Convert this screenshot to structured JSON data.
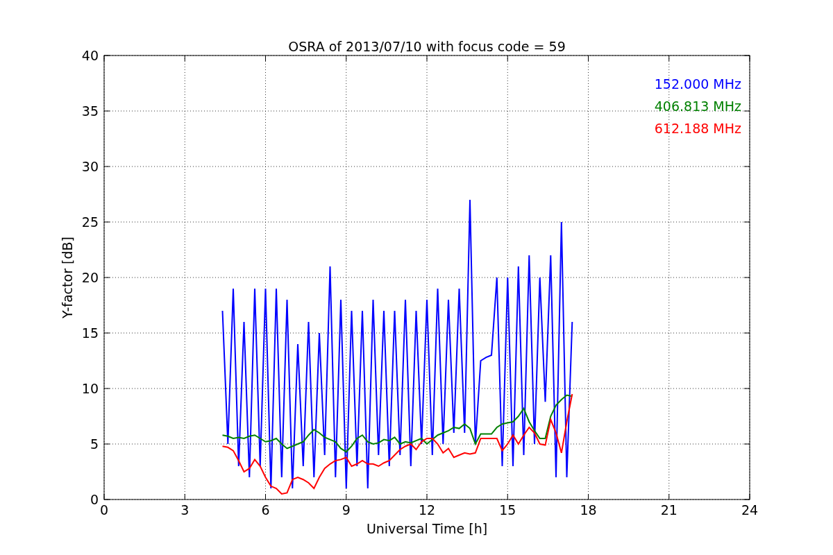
{
  "chart_data": {
    "type": "line",
    "title": "OSRA of 2013/07/10 with focus code = 59",
    "xlabel": "Universal Time [h]",
    "ylabel": "Y-factor [dB]",
    "x": [
      4.4,
      4.6,
      4.8,
      5.0,
      5.2,
      5.4,
      5.6,
      5.8,
      6.0,
      6.2,
      6.4,
      6.6,
      6.8,
      7.0,
      7.2,
      7.4,
      7.6,
      7.8,
      8.0,
      8.2,
      8.4,
      8.6,
      8.8,
      9.0,
      9.2,
      9.4,
      9.6,
      9.8,
      10.0,
      10.2,
      10.4,
      10.6,
      10.8,
      11.0,
      11.2,
      11.4,
      11.6,
      11.8,
      12.0,
      12.2,
      12.4,
      12.6,
      12.8,
      13.0,
      13.2,
      13.4,
      13.6,
      13.8,
      14.0,
      14.2,
      14.4,
      14.6,
      14.8,
      15.0,
      15.2,
      15.4,
      15.6,
      15.8,
      16.0,
      16.2,
      16.4,
      16.6,
      16.8,
      17.0,
      17.2,
      17.4
    ],
    "series": [
      {
        "name": "152.000 MHz",
        "color": "#0000ff",
        "values": [
          17,
          5,
          19,
          3,
          16,
          2,
          19,
          3,
          19,
          1,
          19,
          2,
          18,
          1,
          14,
          3,
          16,
          2,
          15,
          4,
          21,
          2,
          18,
          1,
          17,
          3,
          17,
          1,
          18,
          4,
          17,
          3,
          17,
          4,
          18,
          3,
          17,
          5,
          18,
          4,
          19,
          5,
          18,
          6,
          19,
          6,
          27,
          5,
          12.5,
          12.8,
          13,
          20,
          3,
          20,
          3,
          21,
          4,
          22,
          5,
          20,
          8.8,
          22,
          2,
          25,
          2,
          16
        ]
      },
      {
        "name": "406.813 MHz",
        "color": "#008000",
        "values": [
          5.8,
          5.7,
          5.5,
          5.6,
          5.5,
          5.7,
          5.8,
          5.5,
          5.2,
          5.3,
          5.5,
          5.0,
          4.6,
          4.8,
          5.0,
          5.2,
          5.8,
          6.3,
          6.0,
          5.6,
          5.4,
          5.2,
          4.6,
          4.3,
          4.8,
          5.5,
          5.8,
          5.2,
          5.0,
          5.1,
          5.4,
          5.3,
          5.6,
          5.0,
          5.2,
          5.1,
          5.3,
          5.5,
          5.0,
          5.4,
          5.8,
          6.0,
          6.2,
          6.5,
          6.4,
          6.8,
          6.4,
          5.0,
          5.9,
          5.9,
          5.9,
          6.5,
          6.8,
          6.9,
          7.0,
          7.5,
          8.2,
          7.0,
          6.2,
          5.5,
          5.5,
          7.5,
          8.5,
          9.0,
          9.4,
          9.3
        ]
      },
      {
        "name": "612.188 MHz",
        "color": "#ff0000",
        "values": [
          4.8,
          4.7,
          4.4,
          3.5,
          2.5,
          2.8,
          3.6,
          3.0,
          2.0,
          1.2,
          1.0,
          0.5,
          0.6,
          1.8,
          2.0,
          1.8,
          1.5,
          1.0,
          2.0,
          2.8,
          3.2,
          3.5,
          3.6,
          3.8,
          3.0,
          3.2,
          3.5,
          3.2,
          3.2,
          3.0,
          3.3,
          3.5,
          4.0,
          4.5,
          4.8,
          5.0,
          4.5,
          5.2,
          5.5,
          5.5,
          5.0,
          4.2,
          4.6,
          3.8,
          4.0,
          4.2,
          4.1,
          4.2,
          5.5,
          5.5,
          5.5,
          5.5,
          4.4,
          5.0,
          5.8,
          5.0,
          5.8,
          6.5,
          6.0,
          5.0,
          4.9,
          7.2,
          6.0,
          4.2,
          7.0,
          9.5
        ]
      }
    ],
    "grid": true,
    "xlim": [
      0,
      24
    ],
    "ylim": [
      0,
      40
    ],
    "xticks": [
      0,
      3,
      6,
      9,
      12,
      15,
      18,
      21,
      24
    ],
    "yticks": [
      0,
      5,
      10,
      15,
      20,
      25,
      30,
      35,
      40
    ]
  }
}
